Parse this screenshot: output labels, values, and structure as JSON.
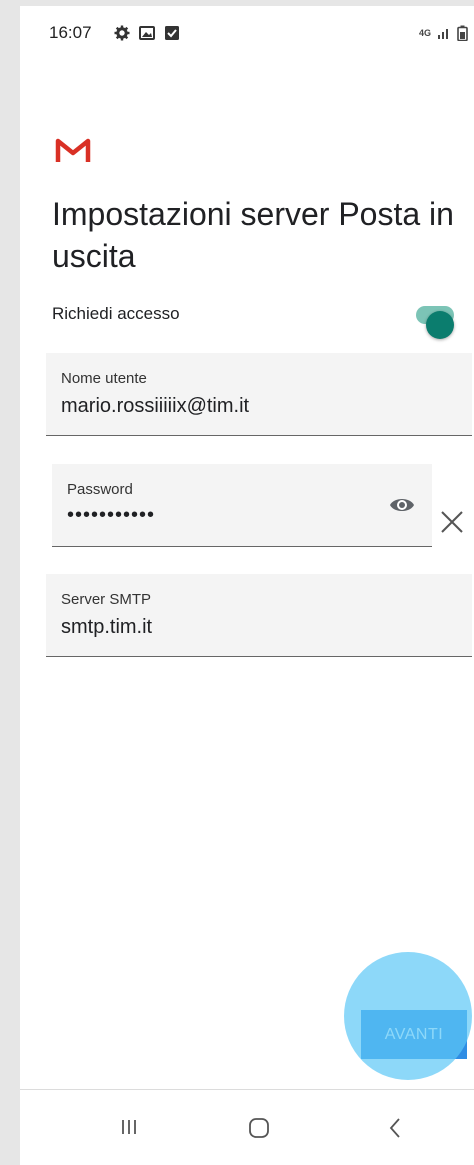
{
  "status_bar": {
    "time": "16:07",
    "left_icons": [
      "gear-icon",
      "image-icon",
      "checkbox-icon"
    ],
    "network": "4G",
    "right_icons": [
      "network-4g-icon",
      "signal-icon",
      "battery-icon"
    ]
  },
  "app": {
    "logo": "gmail-logo",
    "title": "Impostazioni server Posta in uscita"
  },
  "require_access": {
    "label": "Richiedi accesso",
    "enabled": true
  },
  "fields": {
    "username": {
      "label": "Nome utente",
      "value": "mario.rossiiiiix@tim.it"
    },
    "password": {
      "label": "Password",
      "value": "•••••••••••"
    },
    "smtp": {
      "label": "Server SMTP",
      "value": "smtp.tim.it"
    }
  },
  "actions": {
    "next_label": "AVANTI"
  },
  "colors": {
    "accent": "#2f8de4",
    "toggle_on": "#0b7d6e",
    "tap_highlight": "#5cc8f6",
    "gmail_red": "#d93025"
  },
  "navigation": {
    "icons": [
      "recent-apps-icon",
      "home-icon",
      "back-icon"
    ]
  }
}
